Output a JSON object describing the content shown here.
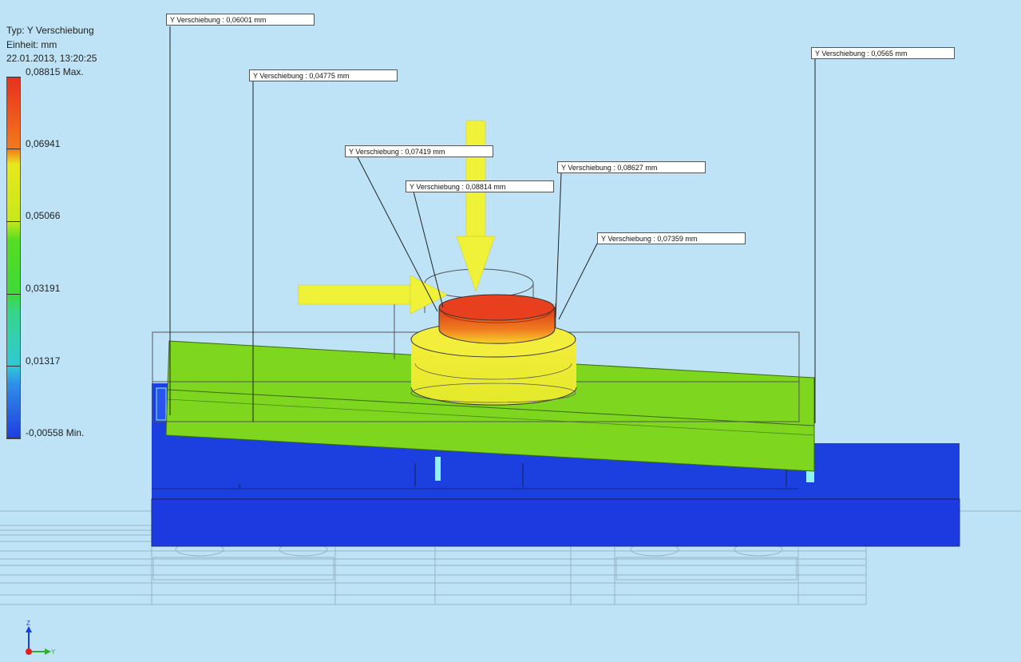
{
  "legend": {
    "type": "Typ: Y Verschiebung",
    "unit": "Einheit: mm",
    "date": "22.01.2013, 13:20:25",
    "ticks": [
      "0,08815 Max.",
      "0,06941",
      "0,05066",
      "0,03191",
      "0,01317",
      "-0,00558 Min."
    ]
  },
  "probes": [
    "Y Verschiebung : 0,06001 mm",
    "Y Verschiebung : 0,04775 mm",
    "Y Verschiebung : 0,0565 mm",
    "Y Verschiebung : 0,07419 mm",
    "Y Verschiebung : 0,08627 mm",
    "Y Verschiebung : 0,08814 mm",
    "Y Verschiebung : 0,07359 mm"
  ],
  "triad": {
    "z": "Z",
    "y": "Y"
  },
  "colors": {
    "background": "#bfe3f6",
    "plate": "#7fd61f",
    "base": "#1c3fe0",
    "arrow": "#f0f23a",
    "hot": "#e8401e"
  }
}
